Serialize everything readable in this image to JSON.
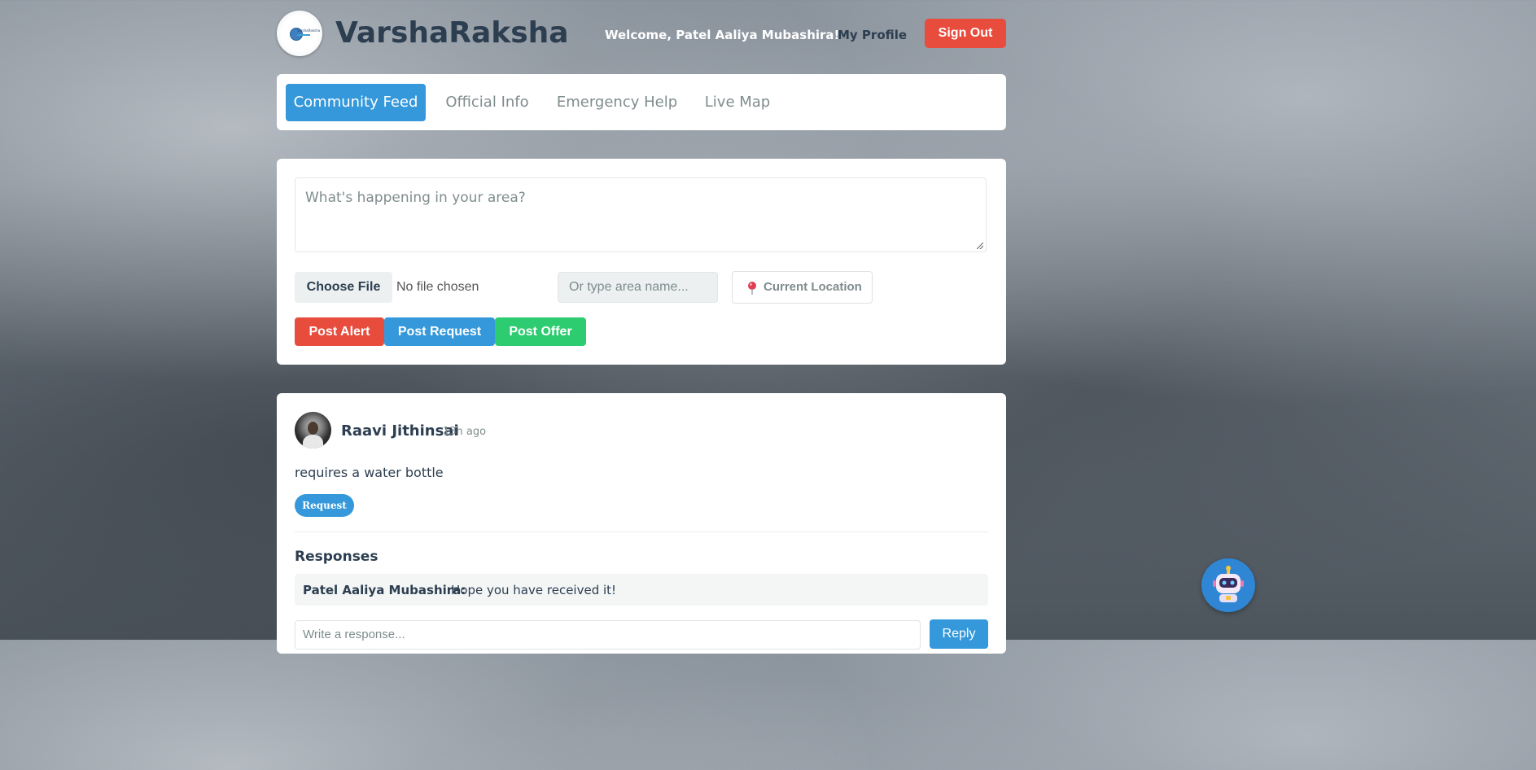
{
  "header": {
    "brand": "VarshaRaksha",
    "logo_text": "VarshaRaksha",
    "welcome": "Welcome, Patel Aaliya Mubashira!",
    "profile_link": "My Profile",
    "signout_label": "Sign Out"
  },
  "tabs": [
    {
      "label": "Community Feed",
      "active": true
    },
    {
      "label": "Official Info",
      "active": false
    },
    {
      "label": "Emergency Help",
      "active": false
    },
    {
      "label": "Live Map",
      "active": false
    }
  ],
  "composer": {
    "textarea_placeholder": "What's happening in your area?",
    "file_button_label": "Choose File",
    "file_status": "No file chosen",
    "area_placeholder": "Or type area name...",
    "location_button_label": "Current Location",
    "post_buttons": [
      {
        "label": "Post Alert",
        "color": "#e74c3c"
      },
      {
        "label": "Post Request",
        "color": "#3498db"
      },
      {
        "label": "Post Offer",
        "color": "#2ecc71"
      }
    ]
  },
  "post": {
    "author": "Raavi Jithinsai",
    "time": "13h ago",
    "content": "requires a water bottle",
    "badge": "Request",
    "responses_title": "Responses",
    "responses": [
      {
        "author": "Patel Aaliya Mubashira:",
        "text": "Hope you have received it!"
      }
    ],
    "reply_placeholder": "Write a response...",
    "reply_button_label": "Reply"
  },
  "colors": {
    "primary": "#3498db",
    "danger": "#e74c3c",
    "success": "#2ecc71",
    "text_dark": "#2c3e50"
  }
}
